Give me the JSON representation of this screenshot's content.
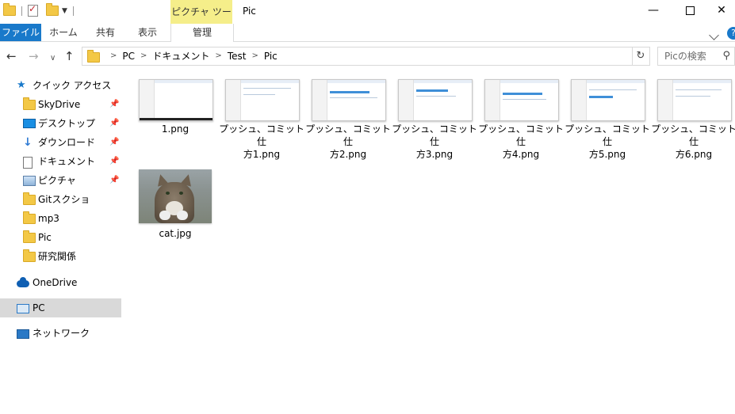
{
  "window": {
    "title": "Pic",
    "context_tab_title": "ピクチャ ツール"
  },
  "ribbon": {
    "tabs": [
      "ファイル",
      "ホーム",
      "共有",
      "表示",
      "管理"
    ],
    "help": "?"
  },
  "navigation": {
    "breadcrumb": [
      "PC",
      "ドキュメント",
      "Test",
      "Pic"
    ],
    "search_placeholder": "Picの検索"
  },
  "sidebar": {
    "quick_access": "クイック アクセス",
    "items": [
      {
        "label": "SkyDrive",
        "pinned": true
      },
      {
        "label": "デスクトップ",
        "pinned": true
      },
      {
        "label": "ダウンロード",
        "pinned": true
      },
      {
        "label": "ドキュメント",
        "pinned": true
      },
      {
        "label": "ピクチャ",
        "pinned": true
      },
      {
        "label": "Gitスクショ",
        "pinned": false
      },
      {
        "label": "mp3",
        "pinned": false
      },
      {
        "label": "Pic",
        "pinned": false
      },
      {
        "label": "研究関係",
        "pinned": false
      }
    ],
    "onedrive": "OneDrive",
    "pc": "PC",
    "network": "ネットワーク"
  },
  "files": [
    {
      "line1": "1.png",
      "line2": ""
    },
    {
      "line1": "プッシュ、コミット仕",
      "line2": "方1.png"
    },
    {
      "line1": "プッシュ、コミット仕",
      "line2": "方2.png"
    },
    {
      "line1": "プッシュ、コミット仕",
      "line2": "方3.png"
    },
    {
      "line1": "プッシュ、コミット仕",
      "line2": "方4.png"
    },
    {
      "line1": "プッシュ、コミット仕",
      "line2": "方5.png"
    },
    {
      "line1": "プッシュ、コミット仕",
      "line2": "方6.png"
    },
    {
      "line1": "cat.jpg",
      "line2": ""
    }
  ]
}
